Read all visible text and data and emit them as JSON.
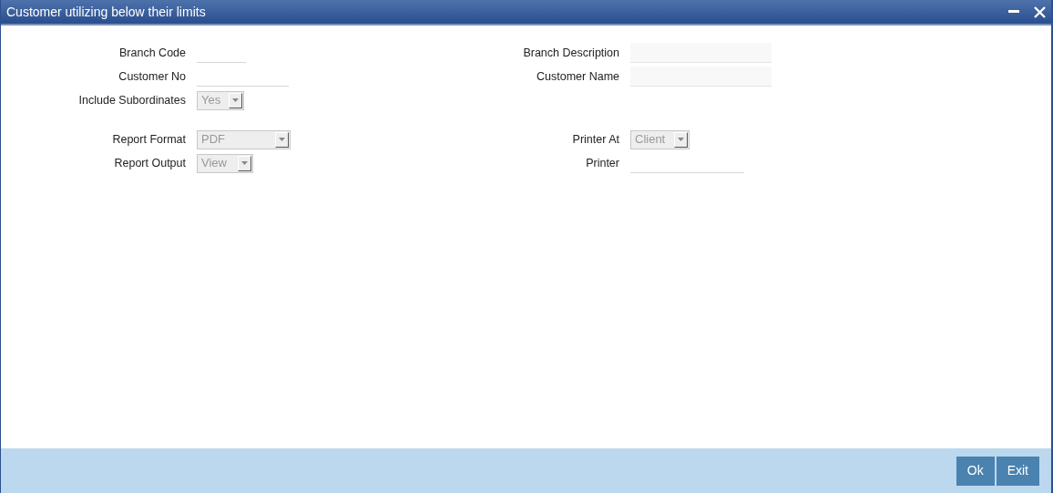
{
  "window": {
    "title": "Customer utilizing below their limits",
    "controls": [
      {
        "kind": "minimize"
      },
      {
        "kind": "close"
      }
    ]
  },
  "groups": [
    {
      "rows": [
        {
          "left": {
            "label": "Branch Code",
            "kind": "text"
          },
          "right": {
            "label": "Branch Description",
            "kind": "readonly"
          }
        },
        {
          "left": {
            "label": "Customer No",
            "kind": "text"
          },
          "right": {
            "label": "Customer Name",
            "kind": "readonly"
          }
        },
        {
          "left": {
            "label": "Include Subordinates",
            "kind": "select",
            "value": "Yes"
          },
          "right": null
        }
      ]
    },
    {
      "rows": [
        {
          "left": {
            "label": "Report Format",
            "kind": "select",
            "value": "PDF"
          },
          "right": {
            "label": "Printer At",
            "kind": "select",
            "value": "Client"
          }
        },
        {
          "left": {
            "label": "Report Output",
            "kind": "select",
            "value": "View"
          },
          "right": {
            "label": "Printer",
            "kind": "text"
          }
        }
      ]
    }
  ],
  "buttons": [
    "Ok",
    "Exit"
  ]
}
